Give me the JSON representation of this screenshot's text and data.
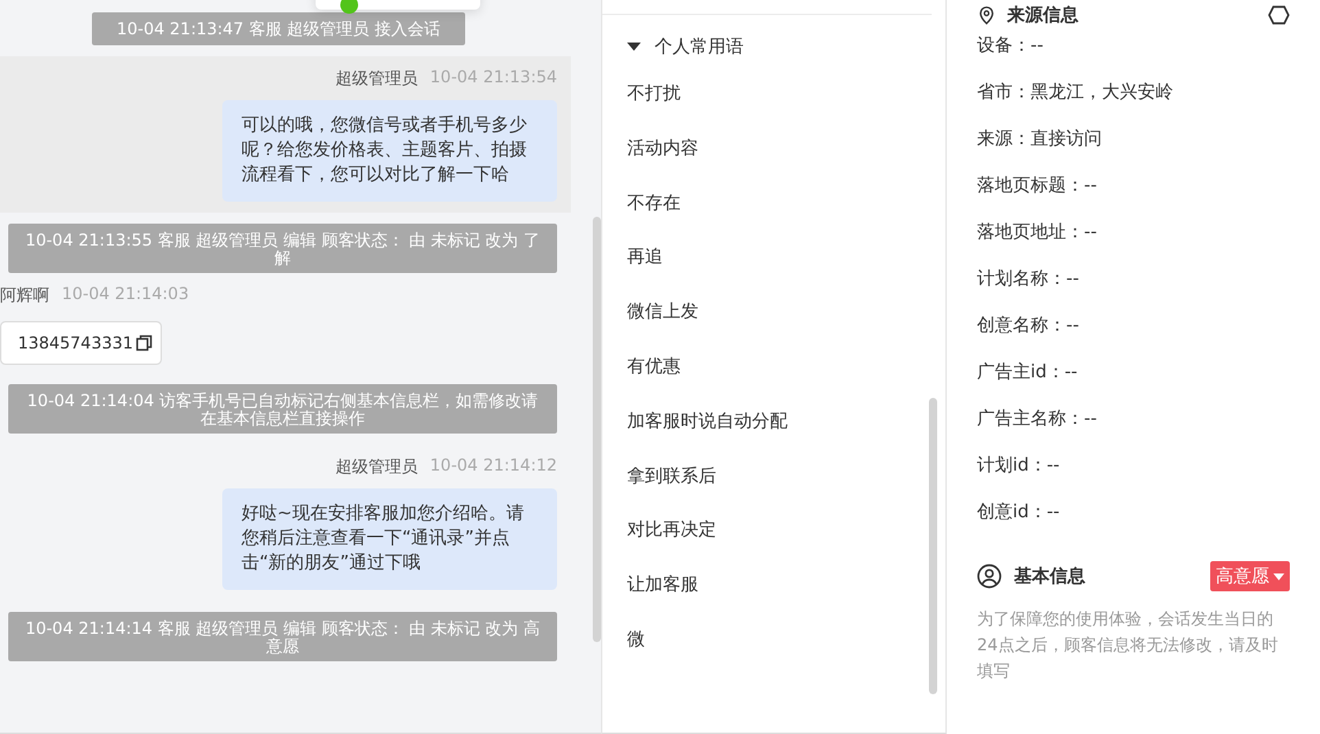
{
  "chat": {
    "messages": [
      {
        "kind": "system",
        "text": "10-04 21:13:47 客服 超级管理员 接入会话",
        "narrow": true
      },
      {
        "kind": "outgoing",
        "sender": "超级管理员",
        "time": "10-04 21:13:54",
        "text": "可以的哦，您微信号或者手机号多少呢？给您发价格表、主题客片、拍摄流程看下，您可以对比了解一下哈",
        "selected": true
      },
      {
        "kind": "system",
        "text": "10-04 21:13:55 客服 超级管理员 编辑 顾客状态： 由 未标记 改为 了解",
        "narrow": false
      },
      {
        "kind": "incoming",
        "sender": "阿辉啊",
        "time": "10-04 21:14:03",
        "text": "13845743331"
      },
      {
        "kind": "system",
        "text": "10-04 21:14:04 访客手机号已自动标记右侧基本信息栏，如需修改请在基本信息栏直接操作",
        "narrow": false
      },
      {
        "kind": "outgoing",
        "sender": "超级管理员",
        "time": "10-04 21:14:12",
        "text": "好哒~现在安排客服加您介绍哈。请您稍后注意查看一下“通讯录”并点击“新的朋友”通过下哦",
        "selected": false
      },
      {
        "kind": "system",
        "text": "10-04 21:14:14 客服 超级管理员 编辑 顾客状态： 由 未标记 改为 高意愿",
        "narrow": false
      }
    ]
  },
  "quick_replies": {
    "group": {
      "label": "个人常用语",
      "expanded": true
    },
    "items": [
      "不打扰",
      "活动内容",
      "不存在",
      "再追",
      "微信上发",
      "有优惠",
      "加客服时说自动分配",
      "拿到联系后",
      "对比再决定",
      "让加客服",
      "微"
    ]
  },
  "source_info": {
    "title": "来源信息",
    "lines": [
      "设备：--",
      "省市：黑龙江，大兴安岭",
      "来源：直接访问",
      "落地页标题：--",
      "落地页地址：--",
      "计划名称：--",
      "创意名称：--",
      "广告主id：--",
      "广告主名称：--",
      "计划id：--",
      "创意id：--"
    ]
  },
  "basic_info": {
    "title": "基本信息",
    "status": {
      "label": "高意愿",
      "color": "#f0505a"
    },
    "note": "为了保障您的使用体验，会话发生当日的24点之后，顾客信息将无法修改，请及时填写"
  }
}
